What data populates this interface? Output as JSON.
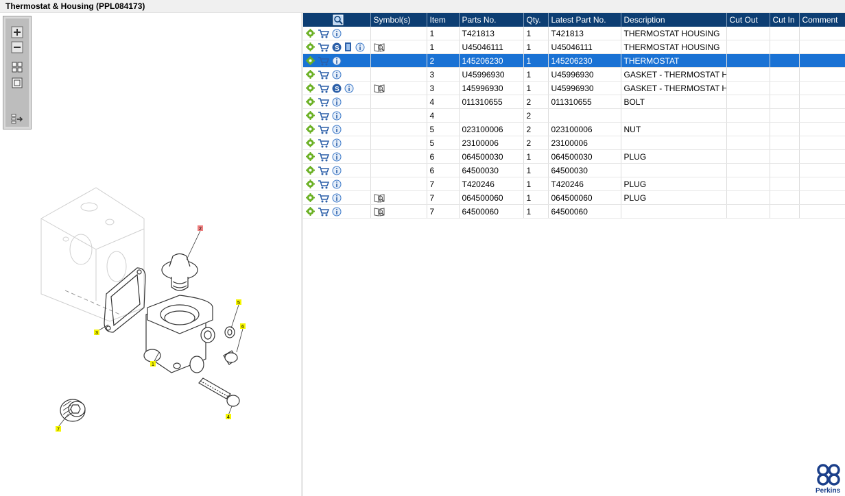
{
  "title": "Thermostat & Housing (PPL084173)",
  "toolbox": {
    "tools": [
      "zoom-in",
      "zoom-out",
      "fit-all",
      "fit-page",
      "toggle-panel"
    ]
  },
  "diagram": {
    "callouts": [
      {
        "label": "2",
        "color": "#f08080"
      },
      {
        "label": "5",
        "color": "#f5f500"
      },
      {
        "label": "6",
        "color": "#f5f500"
      },
      {
        "label": "3",
        "color": "#f5f500"
      },
      {
        "label": "1",
        "color": "#f5f500"
      },
      {
        "label": "4",
        "color": "#f5f500"
      },
      {
        "label": "7",
        "color": "#f5f500"
      }
    ]
  },
  "table": {
    "columns": [
      "",
      "Symbol(s)",
      "Item",
      "Parts No.",
      "Qty.",
      "Latest Part No.",
      "Description",
      "Cut Out",
      "Cut In",
      "Comment"
    ],
    "rows": [
      {
        "icons": [
          "gear",
          "cart",
          "info"
        ],
        "symbols": [],
        "item": "1",
        "part": "T421813",
        "qty": "1",
        "latest": "T421813",
        "desc": "THERMOSTAT HOUSING"
      },
      {
        "icons": [
          "gear",
          "cart",
          "s",
          "book",
          "info"
        ],
        "symbols": [
          "catalog"
        ],
        "item": "1",
        "part": "U45046111",
        "qty": "1",
        "latest": "U45046111",
        "desc": "THERMOSTAT HOUSING"
      },
      {
        "icons": [
          "gear",
          "cart",
          "info"
        ],
        "symbols": [],
        "item": "2",
        "part": "145206230",
        "qty": "1",
        "latest": "145206230",
        "desc": "THERMOSTAT",
        "selected": true
      },
      {
        "icons": [
          "gear",
          "cart",
          "info"
        ],
        "symbols": [],
        "item": "3",
        "part": "U45996930",
        "qty": "1",
        "latest": "U45996930",
        "desc": "GASKET - THERMOSTAT HSG"
      },
      {
        "icons": [
          "gear",
          "cart",
          "s",
          "info"
        ],
        "symbols": [
          "catalog"
        ],
        "item": "3",
        "part": "145996930",
        "qty": "1",
        "latest": "U45996930",
        "desc": "GASKET - THERMOSTAT HSG"
      },
      {
        "icons": [
          "gear",
          "cart",
          "info"
        ],
        "symbols": [],
        "item": "4",
        "part": "011310655",
        "qty": "2",
        "latest": "011310655",
        "desc": "BOLT"
      },
      {
        "icons": [
          "gear",
          "cart",
          "info"
        ],
        "symbols": [],
        "item": "4",
        "part": "",
        "qty": "2",
        "latest": "",
        "desc": ""
      },
      {
        "icons": [
          "gear",
          "cart",
          "info"
        ],
        "symbols": [],
        "item": "5",
        "part": "023100006",
        "qty": "2",
        "latest": "023100006",
        "desc": "NUT"
      },
      {
        "icons": [
          "gear",
          "cart",
          "info"
        ],
        "symbols": [],
        "item": "5",
        "part": "23100006",
        "qty": "2",
        "latest": "23100006",
        "desc": ""
      },
      {
        "icons": [
          "gear",
          "cart",
          "info"
        ],
        "symbols": [],
        "item": "6",
        "part": "064500030",
        "qty": "1",
        "latest": "064500030",
        "desc": "PLUG"
      },
      {
        "icons": [
          "gear",
          "cart",
          "info"
        ],
        "symbols": [],
        "item": "6",
        "part": "64500030",
        "qty": "1",
        "latest": "64500030",
        "desc": ""
      },
      {
        "icons": [
          "gear",
          "cart",
          "info"
        ],
        "symbols": [],
        "item": "7",
        "part": "T420246",
        "qty": "1",
        "latest": "T420246",
        "desc": "PLUG"
      },
      {
        "icons": [
          "gear",
          "cart",
          "info"
        ],
        "symbols": [
          "catalog"
        ],
        "item": "7",
        "part": "064500060",
        "qty": "1",
        "latest": "064500060",
        "desc": "PLUG"
      },
      {
        "icons": [
          "gear",
          "cart",
          "info"
        ],
        "symbols": [
          "catalog"
        ],
        "item": "7",
        "part": "64500060",
        "qty": "1",
        "latest": "64500060",
        "desc": ""
      }
    ]
  },
  "brand": {
    "name": "Perkins",
    "color": "#1b3f8a"
  },
  "colors": {
    "header": "#0d3e73",
    "selected": "#1a72d4",
    "gear": "#6ab023",
    "cart": "#2b5fa8"
  }
}
